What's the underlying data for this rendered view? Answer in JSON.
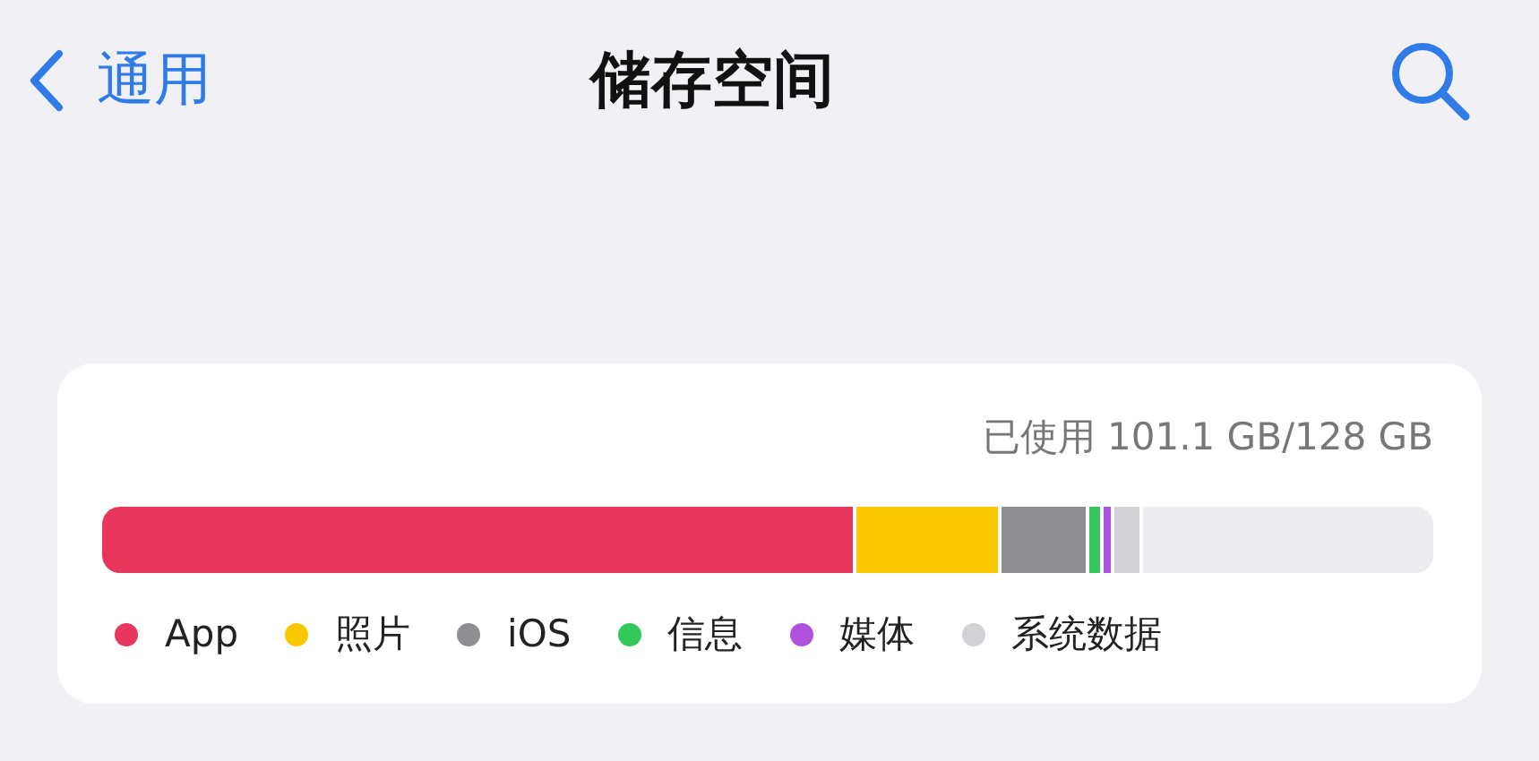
{
  "nav": {
    "back_label": "通用",
    "title": "储存空间"
  },
  "storage": {
    "used_text": "已使用 101.1 GB/128 GB",
    "bar_segments": [
      {
        "color": "#e8365d"
      },
      {
        "color": "#fbc800"
      },
      {
        "color": "#8e8e93"
      },
      {
        "color": "#34c759"
      },
      {
        "color": "#af52de"
      },
      {
        "color": "#d1d1d6"
      }
    ],
    "legend": [
      {
        "label": "App",
        "color": "#e8365d"
      },
      {
        "label": "照片",
        "color": "#fbc800"
      },
      {
        "label": "iOS",
        "color": "#8e8e93"
      },
      {
        "label": "信息",
        "color": "#34c759"
      },
      {
        "label": "媒体",
        "color": "#af52de"
      },
      {
        "label": "系统数据",
        "color": "#d1d1d6"
      }
    ]
  }
}
